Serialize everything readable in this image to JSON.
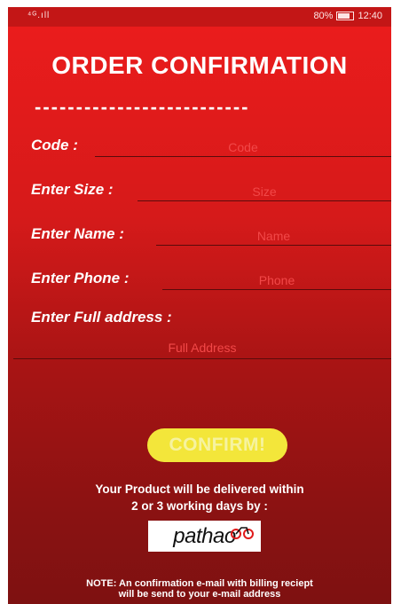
{
  "status_bar": {
    "network": "⁴ᴳ.ıll",
    "battery": "80%",
    "time": "12:40"
  },
  "title": "ORDER CONFIRMATION",
  "divider": "--------------------------",
  "form": {
    "code_label": "Code :",
    "code_placeholder": "Code",
    "size_label": "Enter Size :",
    "size_placeholder": "Size",
    "name_label": "Enter Name :",
    "name_placeholder": "Name",
    "phone_label": "Enter Phone :",
    "phone_placeholder": "Phone",
    "address_label": "Enter Full address :",
    "address_placeholder": "Full Address"
  },
  "confirm_button": "CONFIRM!",
  "delivery_text_line1": "Your Product will be delivered within",
  "delivery_text_line2": "2 or 3 working days by :",
  "logo": "pathao",
  "note_line1": "NOTE: An confirmation e-mail with billing reciept",
  "note_line2": "will be send to your e-mail address",
  "colors": {
    "accent": "#ec1c1c",
    "button": "#f3e63a"
  }
}
